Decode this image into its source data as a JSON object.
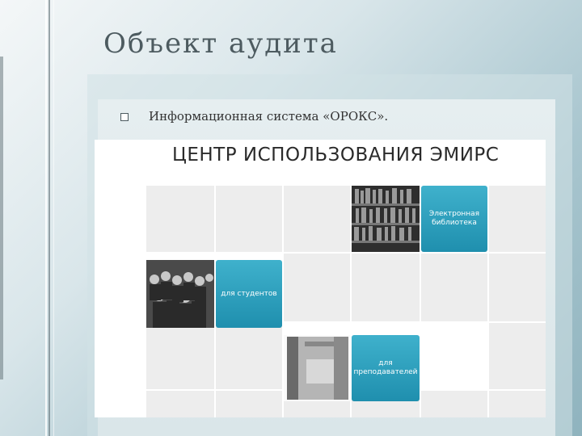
{
  "slide": {
    "title": "Объект аудита",
    "bullet": "Информационная система «ОРОКС»."
  },
  "site": {
    "header": "ЦЕНТР ИСПОЛЬЗОВАНИЯ ЭМИРС",
    "tiles": [
      {
        "label": "Электронная библиотека"
      },
      {
        "label": "для студентов"
      },
      {
        "label": "для преподавателей"
      }
    ]
  },
  "colors": {
    "tile": "#2a9fbd",
    "background": "#a9c6cf",
    "title_text": "#4d5b60"
  }
}
